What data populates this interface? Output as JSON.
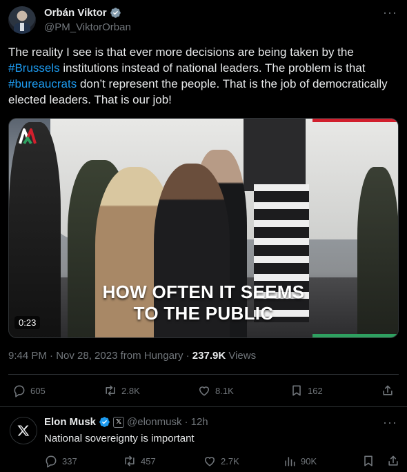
{
  "tweet": {
    "author_name": "Orbán Viktor",
    "author_handle": "@PM_ViktorOrban",
    "more_label": "···",
    "text_parts": {
      "p1": "The reality I see is that ever more decisions are being taken by the ",
      "h1": "#Brussels",
      "p2": " institutions instead of national leaders. The problem is that ",
      "h2": "#bureaucrats",
      "p3": " don’t represent the people. That is the job of democratically elected leaders. That is our job!"
    },
    "media": {
      "caption_line1": "HOW OFTEN IT SEEMS",
      "caption_line2": "TO THE PUBLIC",
      "duration": "0:23"
    },
    "timestamp": "9:44 PM · Nov 28, 2023 from Hungary · ",
    "views_count": "237.9K",
    "views_label": " Views",
    "stats": {
      "replies": "605",
      "reposts": "2.8K",
      "likes": "8.1K",
      "bookmarks": "162"
    }
  },
  "reply": {
    "author_name": "Elon Musk",
    "affiliate_badge": "𝕏",
    "author_handle": "@elonmusk",
    "time": " · 12h",
    "more_label": "···",
    "text": "National sovereignty is important",
    "stats": {
      "replies": "337",
      "reposts": "457",
      "likes": "2.7K",
      "views": "90K"
    }
  },
  "colors": {
    "background": "#000000",
    "text": "#e7e9ea",
    "muted": "#71767b",
    "accent": "#1d9bf0",
    "divider": "#2f3336"
  }
}
